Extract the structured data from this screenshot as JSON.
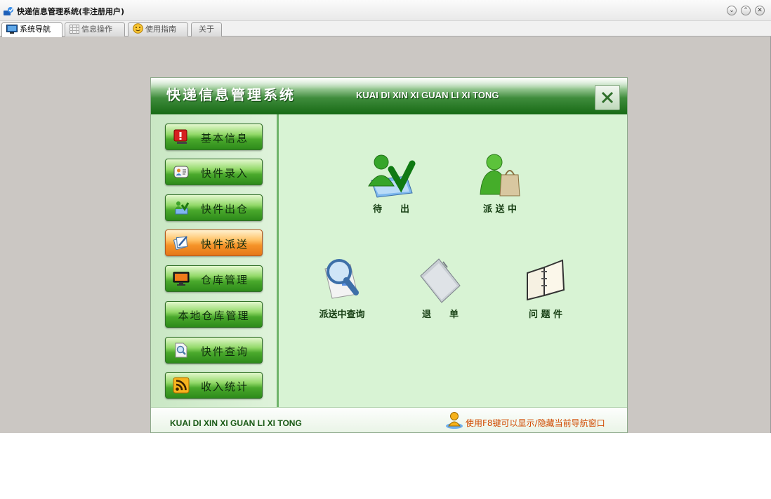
{
  "window": {
    "title": "快递信息管理系统(非注册用户)"
  },
  "tabs": [
    {
      "label": "系统导航",
      "active": true
    },
    {
      "label": "信息操作",
      "active": false
    },
    {
      "label": "使用指南",
      "active": false
    },
    {
      "label": "关于",
      "active": false
    }
  ],
  "panel": {
    "title_cn": "快递信息管理系统",
    "title_en": "KUAI DI XIN XI GUAN LI XI TONG"
  },
  "sidebar": {
    "items": [
      {
        "label": "基本信息",
        "icon": "alert-monitor-icon"
      },
      {
        "label": "快件录入",
        "icon": "contact-card-icon"
      },
      {
        "label": "快件出仓",
        "icon": "user-download-icon"
      },
      {
        "label": "快件派送",
        "icon": "edit-document-icon",
        "active": true
      },
      {
        "label": "仓库管理",
        "icon": "monitor-icon"
      },
      {
        "label": "本地仓库管理",
        "icon": ""
      },
      {
        "label": "快件查询",
        "icon": "search-document-icon"
      },
      {
        "label": "收入统计",
        "icon": "rss-icon"
      }
    ]
  },
  "features": {
    "pending_out": "待　　出",
    "dispatching": "派 送 中",
    "dispatch_query": "派送中查询",
    "return_order": "退　　单",
    "problem_item": "问 题 件"
  },
  "footer": {
    "title_en": "KUAI DI XIN XI GUAN LI XI TONG",
    "hint": "使用F8键可以显示/隐藏当前导航窗口"
  },
  "colors": {
    "header_green": "#176a15",
    "active_orange": "#f59328",
    "hint_text": "#d14a00"
  }
}
